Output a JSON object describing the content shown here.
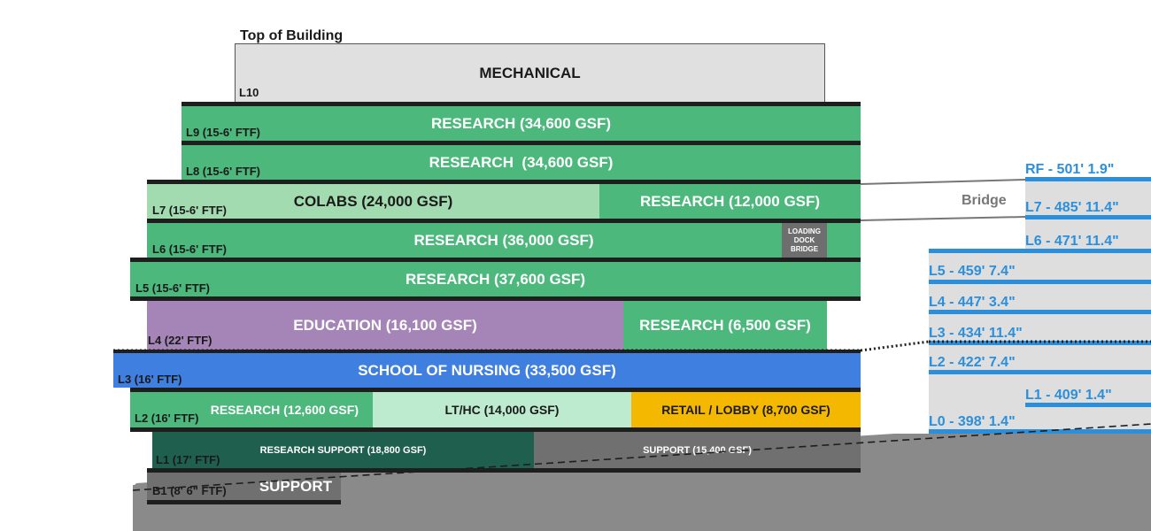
{
  "top_label": "Top of Building",
  "mechanical": "MECHANICAL",
  "bridge_label": "Bridge",
  "levels": {
    "l10": "L10",
    "l9": "L9 (15-6' FTF)",
    "l8": "L8 (15-6' FTF)",
    "l7": "L7 (15-6' FTF)",
    "l6": "L6 (15-6' FTF)",
    "l5": "L5 (15-6' FTF)",
    "l4": "L4 (22' FTF)",
    "l3": "L3 (16' FTF)",
    "l2": "L2 (16' FTF)",
    "l1": "L1 (17' FTF)",
    "b1": "B1 (8' 6\" FTF)"
  },
  "programs": {
    "l9_research": "RESEARCH (34,600 GSF)",
    "l8_research": "RESEARCH  (34,600 GSF)",
    "l7_colabs": "COLABS (24,000 GSF)",
    "l7_research": "RESEARCH (12,000 GSF)",
    "l6_research": "RESEARCH (36,000 GSF)",
    "loading_dock": "LOADING DOCK BRIDGE",
    "l5_research": "RESEARCH (37,600 GSF)",
    "l4_education": "EDUCATION (16,100 GSF)",
    "l4_research": "RESEARCH (6,500 GSF)",
    "l3_nursing": "SCHOOL OF NURSING (33,500 GSF)",
    "l2_research": "RESEARCH (12,600 GSF)",
    "l2_lthc": "LT/HC (14,000 GSF)",
    "l2_retail": "RETAIL / LOBBY (8,700 GSF)",
    "l1_research_support": "RESEARCH SUPPORT (18,800 GSF)",
    "l1_support": "SUPPORT (15,400 GSF)",
    "b1_support": "SUPPORT"
  },
  "elevations": {
    "rf": "RF - 501' 1.9\"",
    "l7": "L7 - 485' 11.4\"",
    "l6": "L6 - 471' 11.4\"",
    "l5": "L5 - 459' 7.4\"",
    "l4": "L4 - 447' 3.4\"",
    "l3": "L3 - 434' 11.4\"",
    "l2": "L2 - 422' 7.4\"",
    "l1": "L1 - 409' 1.4\"",
    "l0": "L0 - 398' 1.4\""
  },
  "colors": {
    "research": "#4cb87c",
    "colabs": "#a2dbaf",
    "education": "#a585b8",
    "nursing": "#3f7fe0",
    "lthc": "#bdebcf",
    "retail": "#f5b800",
    "research_support": "#1f5f4d",
    "support": "#707070",
    "mechanical": "#e0e0e0",
    "elevation": "#2b8fdc"
  }
}
